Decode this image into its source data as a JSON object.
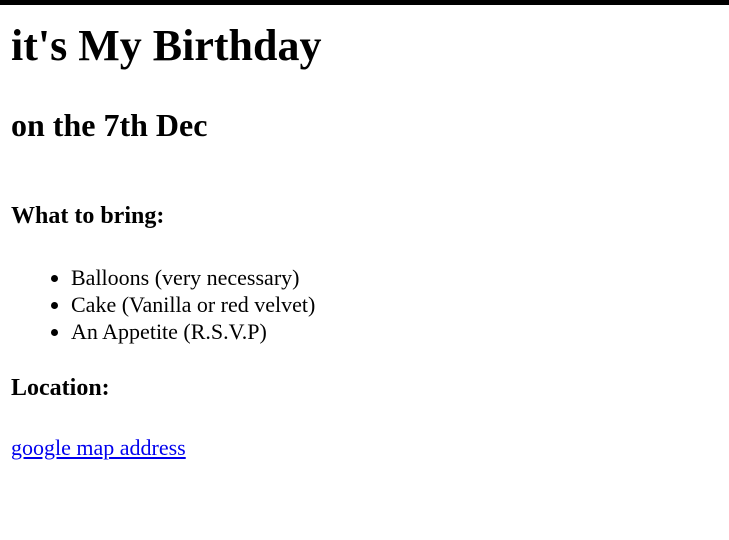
{
  "page": {
    "title": "it's My Birthday",
    "subtitle": "on the 7th Dec"
  },
  "bring": {
    "heading": "What to bring:",
    "items": [
      "Balloons (very necessary)",
      "Cake (Vanilla or red velvet)",
      "An Appetite (R.S.V.P)"
    ]
  },
  "location": {
    "heading": "Location:",
    "link_text": "google map address"
  },
  "colors": {
    "link": "#0000ee",
    "top_bar": "#000000",
    "text": "#000000",
    "background": "#ffffff"
  }
}
